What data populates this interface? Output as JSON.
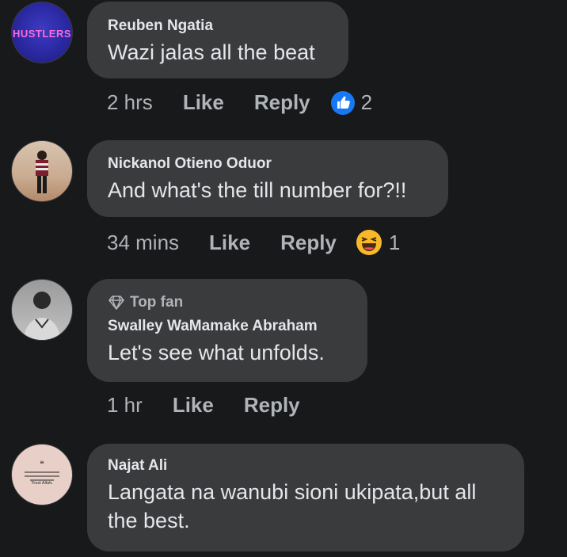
{
  "comments": [
    {
      "author": "Reuben Ngatia",
      "text": "Wazi jalas all the beat",
      "time": "2 hrs",
      "like": "Like",
      "reply": "Reply",
      "reaction_icon": "like-icon",
      "reaction_count": "2",
      "avatar_text": "HUSTLERS"
    },
    {
      "author": "Nickanol Otieno Oduor",
      "text": "And what's the till number for?!!",
      "time": "34 mins",
      "like": "Like",
      "reply": "Reply",
      "reaction_icon": "haha-icon",
      "reaction_count": "1"
    },
    {
      "badge": "Top fan",
      "badge_icon": "diamond-icon",
      "author": "Swalley WaMamake Abraham",
      "text": "Let's see what unfolds.",
      "time": "1 hr",
      "like": "Like",
      "reply": "Reply"
    },
    {
      "author": "Najat Ali",
      "text_lines": [
        "Langata na wanubi sioni ukipata,but all",
        "the best."
      ],
      "avatar_text": "Trust Allah."
    }
  ],
  "colors": {
    "background": "#18191a",
    "bubble": "#3a3b3c",
    "primary_text": "#e4e6eb",
    "secondary_text": "#b0b3b8",
    "like_blue": "#1877f2",
    "haha_yellow": "#f7b928"
  }
}
